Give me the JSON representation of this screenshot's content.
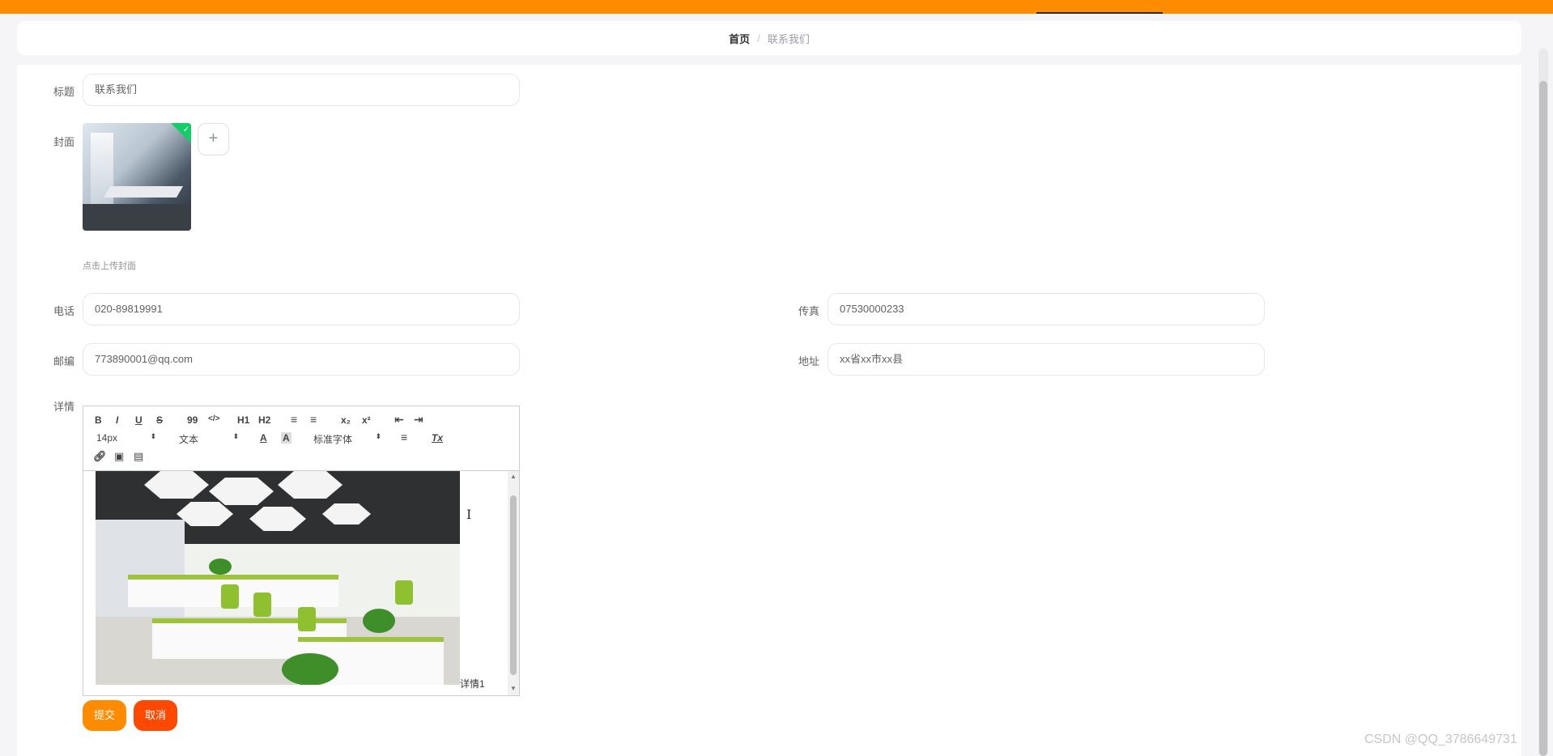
{
  "breadcrumb": {
    "home": "首页",
    "separator": "/",
    "current": "联系我们"
  },
  "form": {
    "title_label": "标题",
    "title_value": "联系我们",
    "cover_label": "封面",
    "cover_hint": "点击上传封面",
    "add_symbol": "+",
    "phone_label": "电话",
    "phone_value": "020-89819991",
    "fax_label": "传真",
    "fax_value": "07530000233",
    "email_label": "邮编",
    "email_value": "773890001@qq.com",
    "address_label": "地址",
    "address_value": "xx省xx市xx县",
    "detail_label": "详情"
  },
  "editor": {
    "toolbar": {
      "bold": "B",
      "italic": "I",
      "underline": "U",
      "strike": "S",
      "quote": "99",
      "code": "</>",
      "h1": "H1",
      "h2": "H2",
      "ordered_list": "≡",
      "bullet_list": "≡",
      "subscript": "x₂",
      "superscript": "x²",
      "outdent": "⇤",
      "indent": "⇥",
      "size": "14px",
      "header": "文本",
      "font": "标准字体",
      "color": "A",
      "background": "A",
      "align": "≡",
      "clean": "Tx"
    },
    "content_text": "详情1"
  },
  "buttons": {
    "submit": "提交",
    "cancel": "取消"
  },
  "watermark": "CSDN @QQ_3786649731",
  "colors": {
    "accent": "#ff8c00",
    "cancel": "#ff4800",
    "check": "#13ce66"
  }
}
